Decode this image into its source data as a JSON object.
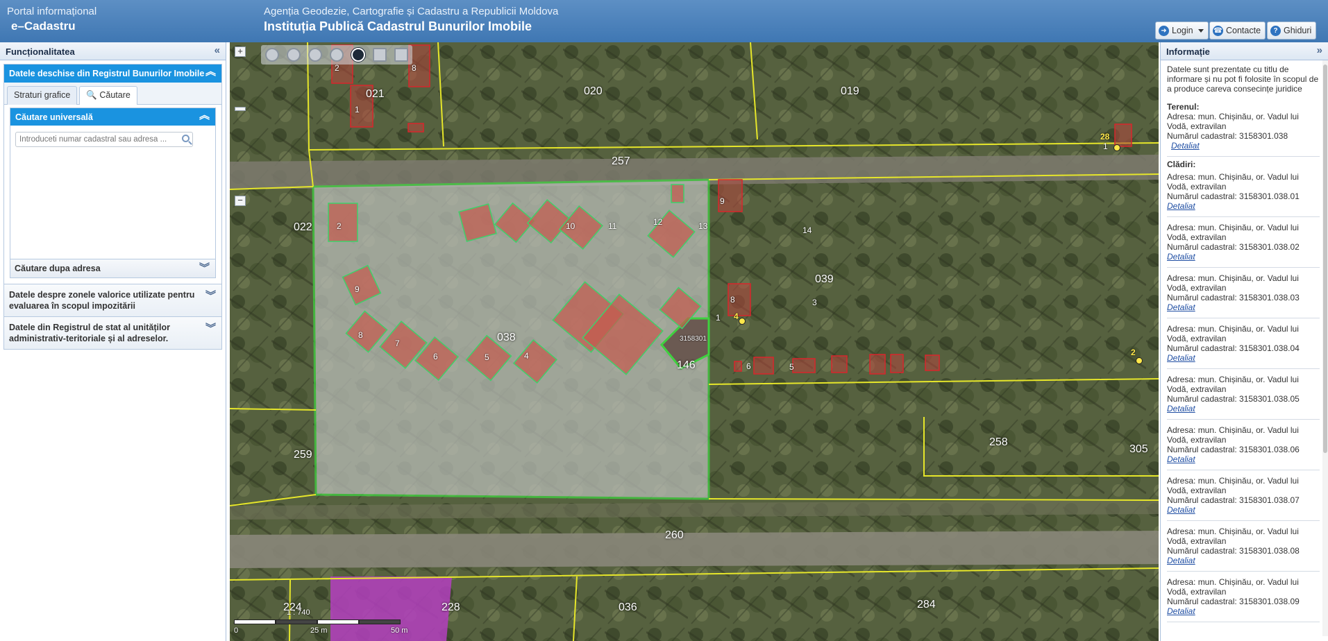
{
  "header": {
    "portal": "Portal informațional",
    "app_name": "e–Cadastru",
    "agency": "Agenția Geodezie, Cartografie și Cadastru a Republicii Moldova",
    "institution": "Instituția Publică Cadastrul Bunurilor Imobile",
    "buttons": {
      "login": "Login",
      "contacte": "Contacte",
      "ghiduri": "Ghiduri"
    }
  },
  "left_panel": {
    "title": "Funcționalitatea",
    "section_title": "Datele deschise din Registrul Bunurilor Imobile",
    "tabs": [
      "Straturi grafice",
      "Căutare"
    ],
    "active_tab": "Căutare",
    "search": {
      "title": "Căutare universală",
      "placeholder": "Introduceti numar cadastral sau adresa ..."
    },
    "address_search": "Căutare dupa adresa",
    "accordion": [
      "Datele despre zonele valorice utilizate pentru evaluarea în scopul impozitării",
      "Datele din Registrul de stat al unităților administrativ-teritoriale și al adreselor."
    ]
  },
  "map": {
    "zoom_in": "+",
    "zoom_out": "−",
    "scale_text": "1 : 740",
    "scale_labels": [
      "0",
      "25 m",
      "50 m"
    ],
    "parcel_labels": [
      {
        "t": "021"
      },
      {
        "t": "020"
      },
      {
        "t": "019"
      },
      {
        "t": "257"
      },
      {
        "t": "022"
      },
      {
        "t": "039"
      },
      {
        "t": "038"
      },
      {
        "t": "146"
      },
      {
        "t": "259"
      },
      {
        "t": "258"
      },
      {
        "t": "305"
      },
      {
        "t": "260"
      },
      {
        "t": "224"
      },
      {
        "t": "228"
      },
      {
        "t": "036"
      },
      {
        "t": "284"
      }
    ],
    "building_numbers": [
      "2",
      "1",
      "8",
      "2",
      "10",
      "11",
      "12",
      "13",
      "14",
      "9",
      "3",
      "8",
      "7",
      "6",
      "5",
      "4",
      "1",
      "4",
      "9",
      "8",
      "6",
      "5",
      "1",
      "28",
      "2"
    ],
    "cadastral_label": "3158301",
    "colors": {
      "parcel_border": "#e6e62a",
      "selected_border": "#3fd13f",
      "building_border": "#d8262c",
      "highlight_parcel": "#b43fbf"
    }
  },
  "right_panel": {
    "title": "Informație",
    "note": "Datele sunt prezentate cu titlu de informare și nu pot fi folosite în scopul de a produce careva consecințe juridice",
    "land_title": "Terenul:",
    "land": {
      "address": "Adresa: mun. Chișinău, or. Vadul lui Vodă, extravilan",
      "number": "Numărul cadastral: 3158301.038",
      "link": "Detaliat"
    },
    "buildings_title": "Clădiri:",
    "buildings": [
      {
        "address": "Adresa: mun. Chișinău, or. Vadul lui Vodă, extravilan",
        "number": "Numărul cadastral: 3158301.038.01",
        "link": "Detaliat"
      },
      {
        "address": "Adresa: mun. Chișinău, or. Vadul lui Vodă, extravilan",
        "number": "Numărul cadastral: 3158301.038.02",
        "link": "Detaliat"
      },
      {
        "address": "Adresa: mun. Chișinău, or. Vadul lui Vodă, extravilan",
        "number": "Numărul cadastral: 3158301.038.03",
        "link": "Detaliat"
      },
      {
        "address": "Adresa: mun. Chișinău, or. Vadul lui Vodă, extravilan",
        "number": "Numărul cadastral: 3158301.038.04",
        "link": "Detaliat"
      },
      {
        "address": "Adresa: mun. Chișinău, or. Vadul lui Vodă, extravilan",
        "number": "Numărul cadastral: 3158301.038.05",
        "link": "Detaliat"
      },
      {
        "address": "Adresa: mun. Chișinău, or. Vadul lui Vodă, extravilan",
        "number": "Numărul cadastral: 3158301.038.06",
        "link": "Detaliat"
      },
      {
        "address": "Adresa: mun. Chișinău, or. Vadul lui Vodă, extravilan",
        "number": "Numărul cadastral: 3158301.038.07",
        "link": "Detaliat"
      },
      {
        "address": "Adresa: mun. Chișinău, or. Vadul lui Vodă, extravilan",
        "number": "Numărul cadastral: 3158301.038.08",
        "link": "Detaliat"
      },
      {
        "address": "Adresa: mun. Chișinău, or. Vadul lui Vodă, extravilan",
        "number": "Numărul cadastral: 3158301.038.09",
        "link": "Detaliat"
      }
    ]
  }
}
